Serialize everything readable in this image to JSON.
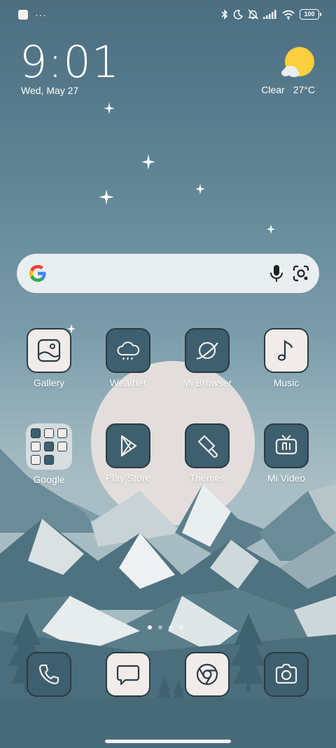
{
  "status_bar": {
    "notification_dots": "···",
    "battery": "100",
    "icons": [
      "bluetooth-icon",
      "moon-icon",
      "bell-off-icon",
      "signal-icon",
      "wifi-icon",
      "battery-icon"
    ]
  },
  "clock_widget": {
    "time": "9:01",
    "date": "Wed, May 27",
    "condition": "Clear",
    "temperature": "27°C"
  },
  "search": {
    "icons": [
      "google-logo-icon",
      "microphone-icon",
      "lens-icon"
    ]
  },
  "apps": [
    {
      "label": "Gallery",
      "icon": "gallery-icon"
    },
    {
      "label": "Weather",
      "icon": "weather-icon"
    },
    {
      "label": "Mi Browser",
      "icon": "browser-icon"
    },
    {
      "label": "Music",
      "icon": "music-icon"
    },
    {
      "label": "Google",
      "icon": "folder-icon"
    },
    {
      "label": "Play Store",
      "icon": "play-store-icon"
    },
    {
      "label": "Themes",
      "icon": "themes-icon"
    },
    {
      "label": "Mi Video",
      "icon": "video-icon"
    }
  ],
  "dock": [
    {
      "icon": "phone-icon"
    },
    {
      "icon": "messages-icon"
    },
    {
      "icon": "chrome-icon"
    },
    {
      "icon": "camera-icon"
    }
  ],
  "pages": {
    "count": 4,
    "active": 1
  },
  "colors": {
    "icon_light": "#f1ecea",
    "icon_dark": "#3d5f6e",
    "icon_stroke": "#2a3b44",
    "sun": "#fbcf3f"
  }
}
